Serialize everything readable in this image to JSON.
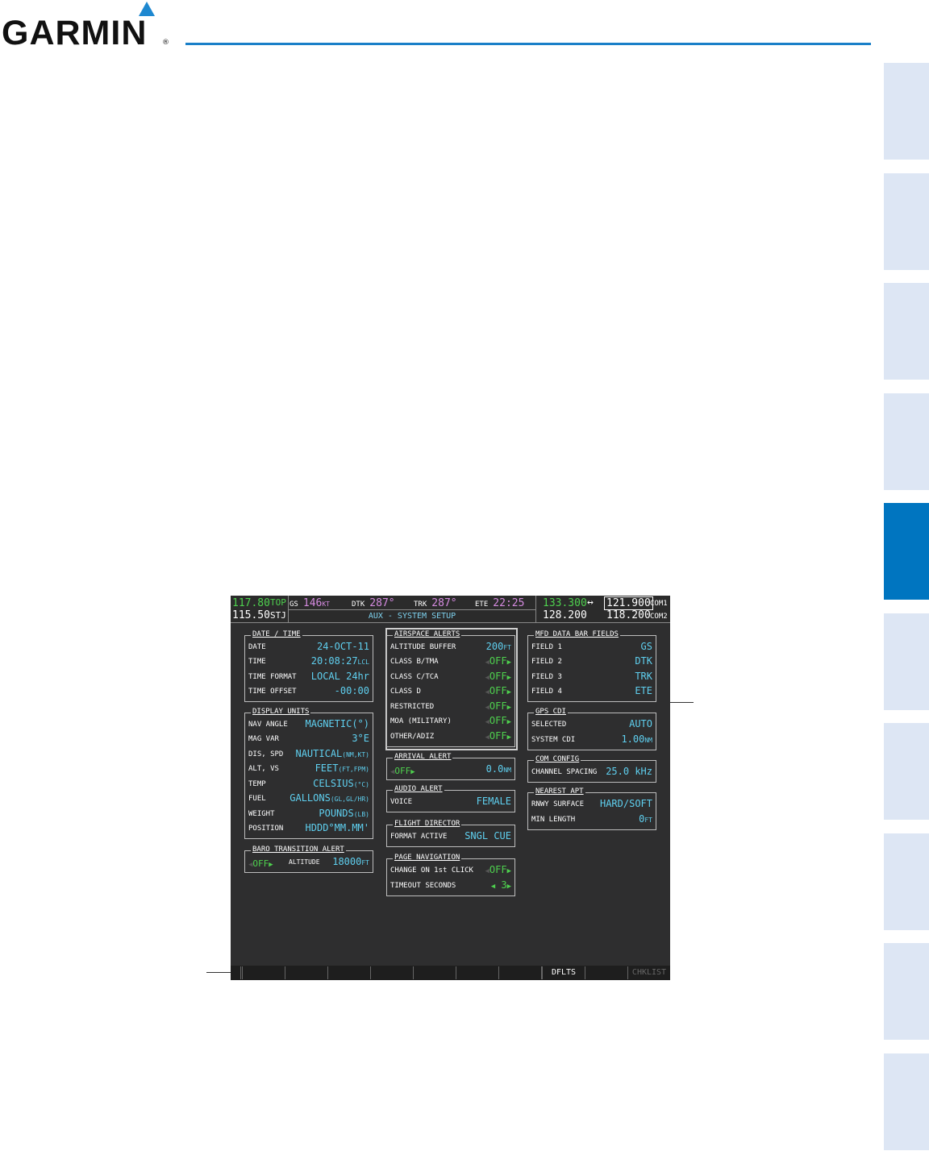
{
  "brand": {
    "name": "GARMIN",
    "reg": "®",
    "rule_color": "#1a7fc8",
    "triangle_color": "#1e88d0"
  },
  "tabs": {
    "count": 10,
    "active_index": 4,
    "active_color": "#0075c0",
    "inactive_color": "#dde6f4"
  },
  "screen": {
    "nav": {
      "active": "117.80",
      "active_id": "TOP",
      "standby": "115.50",
      "standby_id": "STJ"
    },
    "data_fields": [
      {
        "label": "GS",
        "value": "146",
        "unit": "KT"
      },
      {
        "label": "DTK",
        "value": "287°",
        "unit": ""
      },
      {
        "label": "TRK",
        "value": "287°",
        "unit": ""
      },
      {
        "label": "ETE",
        "value": "22:25",
        "unit": ""
      }
    ],
    "page_title": "AUX - SYSTEM SETUP",
    "com": {
      "com1_active": "133.300",
      "arrow": "↔",
      "com1_selected": "121.900",
      "com1_id": "COM1",
      "com2_active": "128.200",
      "com2_standby": "118.200",
      "com2_id": "COM2"
    },
    "date_time": {
      "title": "DATE / TIME",
      "rows": [
        {
          "label": "DATE",
          "value": "24-OCT-11",
          "unit": ""
        },
        {
          "label": "TIME",
          "value": "20:08:27",
          "unit": "LCL"
        },
        {
          "label": "TIME FORMAT",
          "value": "LOCAL 24hr",
          "unit": ""
        },
        {
          "label": "TIME OFFSET",
          "value": "-00:00",
          "unit": ""
        }
      ]
    },
    "display_units": {
      "title": "DISPLAY UNITS",
      "rows": [
        {
          "label": "NAV ANGLE",
          "value": "MAGNETIC(°)",
          "unit": ""
        },
        {
          "label": "MAG VAR",
          "value": "3°E",
          "unit": ""
        },
        {
          "label": "DIS, SPD",
          "value": "NAUTICAL",
          "unit": "(NM,KT)"
        },
        {
          "label": "ALT, VS",
          "value": "FEET",
          "unit": "(FT,FPM)"
        },
        {
          "label": "TEMP",
          "value": "CELSIUS",
          "unit": "(°C)"
        },
        {
          "label": "FUEL",
          "value": "GALLONS",
          "unit": "(GL,GL/HR)"
        },
        {
          "label": "WEIGHT",
          "value": "POUNDS",
          "unit": "(LB)"
        },
        {
          "label": "POSITION",
          "value": "HDDD°MM.MM'",
          "unit": ""
        }
      ]
    },
    "baro": {
      "title": "BARO TRANSITION ALERT",
      "state": "OFF",
      "alt_label": "ALTITUDE",
      "alt_value": "18000",
      "alt_unit": "FT"
    },
    "airspace_alerts": {
      "title": "AIRSPACE ALERTS",
      "rows": [
        {
          "label": "ALTITUDE BUFFER",
          "value": "200",
          "unit": "FT"
        },
        {
          "label": "CLASS B/TMA",
          "value": "OFF",
          "unit": ""
        },
        {
          "label": "CLASS C/TCA",
          "value": "OFF",
          "unit": ""
        },
        {
          "label": "CLASS D",
          "value": "OFF",
          "unit": ""
        },
        {
          "label": "RESTRICTED",
          "value": "OFF",
          "unit": ""
        },
        {
          "label": "MOA (MILITARY)",
          "value": "OFF",
          "unit": ""
        },
        {
          "label": "OTHER/ADIZ",
          "value": "OFF",
          "unit": ""
        }
      ]
    },
    "arrival_alert": {
      "title": "ARRIVAL ALERT",
      "state": "OFF",
      "value": "0.0",
      "unit": "NM"
    },
    "audio_alert": {
      "title": "AUDIO ALERT",
      "label": "VOICE",
      "value": "FEMALE"
    },
    "flight_director": {
      "title": "FLIGHT DIRECTOR",
      "label": "FORMAT ACTIVE",
      "value": "SNGL CUE"
    },
    "page_navigation": {
      "title": "PAGE NAVIGATION",
      "rows": [
        {
          "label": "CHANGE ON 1st CLICK",
          "value": "OFF"
        },
        {
          "label": "TIMEOUT SECONDS",
          "value": "3"
        }
      ]
    },
    "mfd_data_bar": {
      "title": "MFD DATA BAR FIELDS",
      "rows": [
        {
          "label": "FIELD 1",
          "value": "GS"
        },
        {
          "label": "FIELD 2",
          "value": "DTK"
        },
        {
          "label": "FIELD 3",
          "value": "TRK"
        },
        {
          "label": "FIELD 4",
          "value": "ETE"
        }
      ]
    },
    "gps_cdi": {
      "title": "GPS CDI",
      "rows": [
        {
          "label": "SELECTED",
          "value": "AUTO",
          "unit": ""
        },
        {
          "label": "SYSTEM CDI",
          "value": "1.00",
          "unit": "NM"
        }
      ]
    },
    "com_config": {
      "title": "COM CONFIG",
      "label": "CHANNEL SPACING",
      "value": "25.0 kHz"
    },
    "nearest_apt": {
      "title": "NEAREST APT",
      "rows": [
        {
          "label": "RNWY SURFACE",
          "value": "HARD/SOFT",
          "unit": ""
        },
        {
          "label": "MIN LENGTH",
          "value": "0",
          "unit": "FT"
        }
      ]
    },
    "softkeys": [
      "",
      "",
      "",
      "",
      "",
      "",
      "",
      "",
      "DFLTS",
      "",
      "CHKLIST"
    ]
  }
}
